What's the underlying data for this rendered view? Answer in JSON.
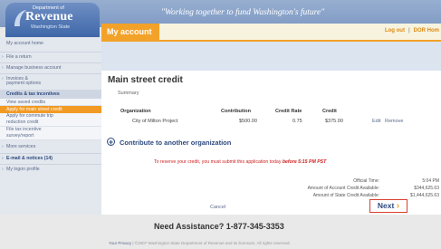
{
  "header": {
    "logo": {
      "dept": "Department of",
      "name": "Revenue",
      "state": "Washington State"
    },
    "tagline": "\"Working together to fund Washington's future\""
  },
  "sidebar": {
    "items": [
      {
        "label": "My account home"
      },
      {
        "label": "File a return"
      },
      {
        "label": "Manage business account"
      },
      {
        "label": "Invoices &"
      },
      {
        "label": "payment options"
      },
      {
        "label": "Credits & tax incentives"
      },
      {
        "label": "View saved credits"
      },
      {
        "label": "Apply for main street credit"
      },
      {
        "label": "Apply for commute trip"
      },
      {
        "label": "reduction credit"
      },
      {
        "label": "File tax incentive"
      },
      {
        "label": "survey/report"
      },
      {
        "label": "More services"
      },
      {
        "label": "E-mail & notices (14)"
      },
      {
        "label": "My logon profile"
      }
    ]
  },
  "main": {
    "tab_label": "My account",
    "logout_label": "Log out",
    "dor_label": "DOR Hom",
    "page_title": "Main street credit",
    "summary_label": "Summary",
    "table": {
      "headers": [
        "Organization",
        "Contribution",
        "Credit Rate",
        "Credit"
      ],
      "row": {
        "organization": "City of Milton Project",
        "contribution": "$500.00",
        "rate": "0.75",
        "credit": "$375.00",
        "edit": "Edit",
        "remove": "Remove"
      }
    },
    "contribute_label": "Contribute to another organization",
    "reserve_prefix": "To reserve your credit, you must submit this application today",
    "reserve_deadline": "before 5:15 PM PST",
    "official_time_label": "Official Time:",
    "official_time_value": "5:04 PM",
    "account_credit_label": "Amount of Account Credit Available:",
    "account_credit_value": "$344,625.63",
    "state_credit_label": "Amount of State Credit Available:",
    "state_credit_value": "$1,444,625.63",
    "cancel_label": "Cancel",
    "next_label": "Next"
  },
  "footer": {
    "assistance": "Need Assistance? 1-877-345-3353",
    "privacy": "Your Privacy",
    "copyright": "| ©2007 Washington State Department of Revenue and its licensors. All rights reserved."
  },
  "colors": {
    "accent": "#f3a229",
    "nav_blue": "#2d4a7f",
    "alert_red": "#cc2222"
  }
}
